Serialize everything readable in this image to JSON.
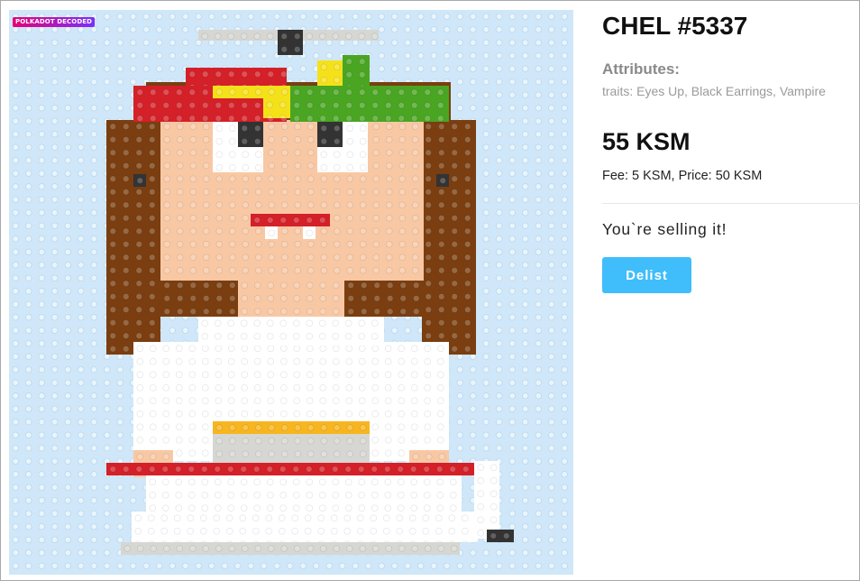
{
  "nft": {
    "watermark": "POLKADOT DECODED",
    "title": "CHEL #5337",
    "attributes_heading": "Attributes:",
    "traits": "traits: Eyes Up, Black Earrings, Vampire",
    "price": "55 KSM",
    "fee_price": "Fee: 5 KSM, Price: 50 KSM",
    "status": "You`re selling it!",
    "delist_label": "Delist"
  },
  "colors": {
    "board": "#cfe7f8",
    "hair": "#7a3e10",
    "skin": "#f8c8a4",
    "white": "#ffffff",
    "red": "#d42028",
    "yellow": "#f5e11a",
    "green": "#4aa523",
    "dark": "#333333",
    "gray": "#d6d6d2",
    "orange": "#f7b51f",
    "accent": "#40bdfb"
  }
}
